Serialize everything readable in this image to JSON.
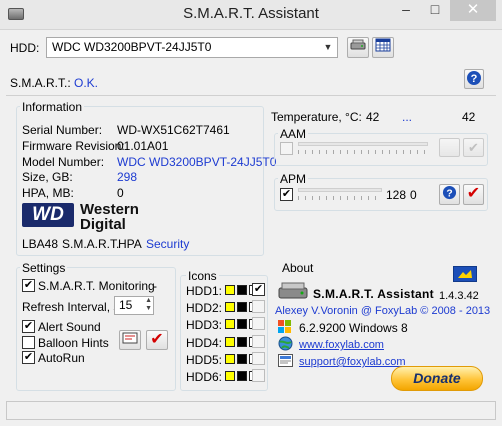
{
  "window": {
    "title": "S.M.A.R.T. Assistant",
    "minimize": "–",
    "maximize": "□",
    "close": "✕"
  },
  "hdd": {
    "label": "HDD:",
    "selected": "WDC WD3200BPVT-24JJ5T0"
  },
  "smart": {
    "label": "S.M.A.R.T.:",
    "status": "O.K."
  },
  "information": {
    "title": "Information",
    "rows": [
      {
        "label": "Serial Number:",
        "value": "WD-WX51C62T7461"
      },
      {
        "label": "Firmware Revision:",
        "value": "01.01A01"
      },
      {
        "label": "Model Number:",
        "value": "WDC WD3200BPVT-24JJ5T0"
      },
      {
        "label": "Size, GB:",
        "value": "298"
      },
      {
        "label": "HPA, MB:",
        "value": "0"
      }
    ],
    "brand_line1": "Western",
    "brand_line2": "Digital",
    "brand_mark": "WD",
    "features": {
      "lba": "LBA48",
      "smart": "S.M.A.R.T.",
      "hpa": "HPA",
      "security": "Security"
    }
  },
  "temperature": {
    "label": "Temperature, °C:",
    "current": "42",
    "dots": "...",
    "max": "42"
  },
  "aam": {
    "title": "AAM"
  },
  "apm": {
    "title": "APM",
    "value1": "128",
    "value2": "0"
  },
  "settings": {
    "title": "Settings",
    "monitoring": {
      "label": "S.M.A.R.T. Monitoring",
      "extra": "-"
    },
    "refresh": {
      "label": "Refresh Interval, s",
      "value": "15"
    },
    "alert": {
      "label": "Alert Sound"
    },
    "balloon": {
      "label": "Balloon Hints"
    },
    "autorun": {
      "label": "AutoRun"
    }
  },
  "icons": {
    "title": "Icons",
    "rows": [
      "HDD1:",
      "HDD2:",
      "HDD3:",
      "HDD4:",
      "HDD5:",
      "HDD6:"
    ]
  },
  "about": {
    "title": "About",
    "app_name": "S.M.A.R.T. Assistant",
    "version": "1.4.3.42",
    "author": "Alexey V.Voronin @ FoxyLab © 2008 - 2013",
    "os": "6.2.9200 Windows 8",
    "website": "www.foxylab.com",
    "email": "support@foxylab.com",
    "donate": "Donate"
  },
  "colors": {
    "link": "#1d3bd1",
    "ok_check": "#d40000",
    "help": "#1c4fb8",
    "icon_yellow": "#ffff00"
  }
}
